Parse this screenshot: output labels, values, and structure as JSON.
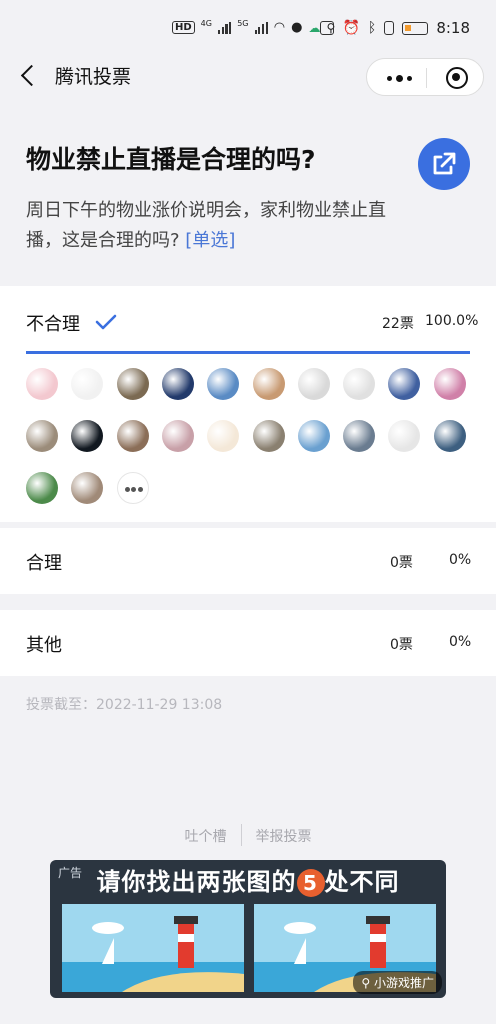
{
  "status_bar": {
    "left_icons": [
      "HD",
      "4G",
      "5G",
      "wifi",
      "wechat",
      "cloud",
      "antenna"
    ],
    "right_icons": [
      "nfc",
      "alarm",
      "bluetooth",
      "vibrate",
      "battery"
    ],
    "time": "8:18",
    "net_4g": "4G",
    "net_5g": "5G",
    "hd": "HD"
  },
  "header": {
    "title": "腾讯投票"
  },
  "vote": {
    "title": "物业禁止直播是合理的吗?",
    "description": "周日下午的物业涨价说明会，家利物业禁止直播，这是合理的吗?",
    "type_tag": "[单选]"
  },
  "options": [
    {
      "label": "不合理",
      "count": "22票",
      "percent": "100.0%",
      "selected": true,
      "progress": 1.0
    },
    {
      "label": "合理",
      "count": "0票",
      "percent": "0%",
      "selected": false,
      "progress": 0
    },
    {
      "label": "其他",
      "count": "0票",
      "percent": "0%",
      "selected": false,
      "progress": 0
    }
  ],
  "voters": [
    "#f3c8cf",
    "#f1f1f1",
    "#7b6a52",
    "#223a6b",
    "#5a8bc4",
    "#c89a72",
    "#d9d9d9",
    "#e0e0e0",
    "#4060a0",
    "#d080a8",
    "#9b8c7a",
    "#111820",
    "#8b6e58",
    "#c8a0a8",
    "#f4e8d8",
    "#8a8070",
    "#6aa0d0",
    "#6a7c90",
    "#e6e6e6",
    "#3d5f80",
    "#4c8a4a",
    "#a08a78"
  ],
  "deadline": "投票截至：2022-11-29 13:08",
  "footer": {
    "feedback": "吐个槽",
    "report": "举报投票"
  },
  "ad": {
    "label": "广告",
    "headline_before": "请你找出两张图的",
    "headline_number": "5",
    "headline_after": "处不同",
    "promo": "小游戏推广"
  },
  "colors": {
    "accent": "#3a6fe0",
    "link": "#4a77d6",
    "background": "#f2f2f5"
  }
}
